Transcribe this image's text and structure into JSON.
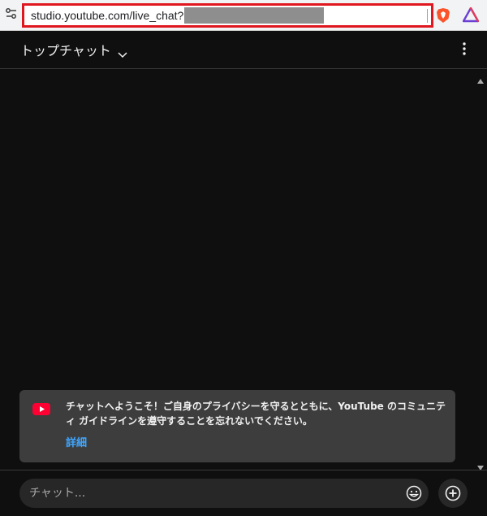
{
  "browser": {
    "url_prefix": "studio.youtube.com/live_chat?"
  },
  "header": {
    "title": "トップチャット"
  },
  "welcome": {
    "message": "チャットへようこそ！ご自身のプライバシーを守るとともに、YouTube のコミュニティ ガイドラインを遵守することを忘れないでください。",
    "learn_more": "詳細"
  },
  "input": {
    "placeholder": "チャット..."
  },
  "colors": {
    "background": "#0f0f0f",
    "card": "#3d3d3d",
    "link": "#3ea6ff",
    "youtube_red": "#ff0033",
    "highlight_border": "#e0171f"
  },
  "icons": {
    "site_info": "tune-icon",
    "brave": "brave-shield-icon",
    "rewards": "brave-rewards-icon",
    "chevron": "chevron-down-icon",
    "more": "more-vert-icon",
    "youtube": "youtube-icon",
    "emoji": "emoji-icon",
    "add": "add-circle-icon"
  }
}
